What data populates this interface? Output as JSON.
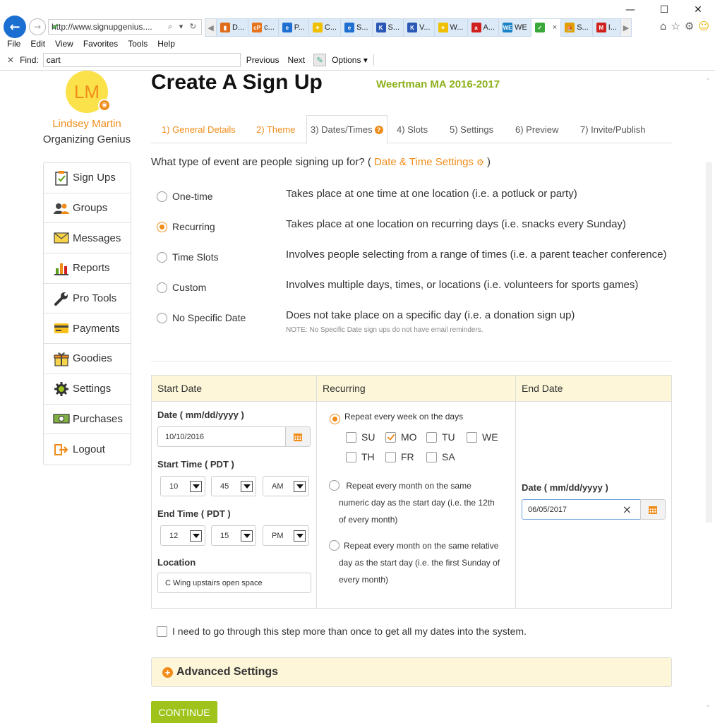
{
  "browser": {
    "address": "http://www.signupgenius....",
    "address_tools": "⌕ ▾ ↻",
    "tabs": [
      {
        "label": "D...",
        "color": "#e06b1a",
        "glyph": "▮"
      },
      {
        "label": "c...",
        "color": "#e8731c",
        "glyph": "cP"
      },
      {
        "label": "P...",
        "color": "#1e6fd0",
        "glyph": "e"
      },
      {
        "label": "C...",
        "color": "#f0c000",
        "glyph": "✦"
      },
      {
        "label": "S...",
        "color": "#1e6fd0",
        "glyph": "e"
      },
      {
        "label": "S...",
        "color": "#2b57b5",
        "glyph": "K"
      },
      {
        "label": "V...",
        "color": "#2b57b5",
        "glyph": "K"
      },
      {
        "label": "W...",
        "color": "#f0c000",
        "glyph": "✦"
      },
      {
        "label": "A...",
        "color": "#d0201e",
        "glyph": "a"
      },
      {
        "label": "WE",
        "color": "#1b82c8",
        "glyph": "WE"
      },
      {
        "label": "",
        "color": "#3aa83a",
        "glyph": "✓",
        "active": true,
        "close": "×"
      },
      {
        "label": "S...",
        "color": "#e0a000",
        "glyph": "⛵"
      },
      {
        "label": "I...",
        "color": "#d0201e",
        "glyph": "M"
      }
    ],
    "menu": [
      "File",
      "Edit",
      "View",
      "Favorites",
      "Tools",
      "Help"
    ],
    "find": {
      "label": "Find:",
      "value": "cart",
      "previous": "Previous",
      "next": "Next",
      "options": "Options ▾"
    }
  },
  "user": {
    "initials": "LM",
    "name": "Lindsey Martin",
    "role": "Organizing Genius"
  },
  "sidebar": {
    "items": [
      {
        "label": "Sign Ups",
        "icon": "clipboard-check-icon"
      },
      {
        "label": "Groups",
        "icon": "people-icon"
      },
      {
        "label": "Messages",
        "icon": "envelope-icon"
      },
      {
        "label": "Reports",
        "icon": "bar-chart-icon"
      },
      {
        "label": "Pro Tools",
        "icon": "wrench-icon"
      },
      {
        "label": "Payments",
        "icon": "credit-card-icon"
      },
      {
        "label": "Goodies",
        "icon": "gift-icon"
      },
      {
        "label": "Settings",
        "icon": "gear-icon"
      },
      {
        "label": "Purchases",
        "icon": "money-icon"
      },
      {
        "label": "Logout",
        "icon": "logout-icon"
      }
    ]
  },
  "header": {
    "title": "Create A Sign Up",
    "group": "Weertman MA 2016-2017"
  },
  "steps": [
    {
      "label": "1) General Details",
      "state": "done"
    },
    {
      "label": "2) Theme",
      "state": "done"
    },
    {
      "label": "3) Dates/Times",
      "state": "current"
    },
    {
      "label": "4) Slots",
      "state": "todo"
    },
    {
      "label": "5) Settings",
      "state": "todo"
    },
    {
      "label": "6) Preview",
      "state": "todo"
    },
    {
      "label": "7) Invite/Publish",
      "state": "todo"
    }
  ],
  "question": {
    "text": "What type of event are people signing up for? (",
    "link": "Date & Time Settings",
    "close": ")"
  },
  "event_types": [
    {
      "label": "One-time",
      "desc": "Takes place at one time at one location (i.e. a potluck or party)",
      "selected": false
    },
    {
      "label": "Recurring",
      "desc": "Takes place at one location on recurring days (i.e. snacks every Sunday)",
      "selected": true
    },
    {
      "label": "Time Slots",
      "desc": "Involves people selecting from a range of times (i.e. a parent teacher conference)",
      "selected": false
    },
    {
      "label": "Custom",
      "desc": "Involves multiple days, times, or locations (i.e. volunteers for sports games)",
      "selected": false
    },
    {
      "label": "No Specific Date",
      "desc": "Does not take place on a specific day (i.e. a donation sign up)",
      "selected": false
    }
  ],
  "note": "NOTE: No Specific Date sign ups do not have email reminders.",
  "start": {
    "header": "Start Date",
    "date_label": "Date ( mm/dd/yyyy )",
    "date_value": "10/10/2016",
    "start_time_label": "Start Time ( PDT )",
    "start_hour": "10",
    "start_min": "45",
    "start_ampm": "AM",
    "end_time_label": "End Time ( PDT )",
    "end_hour": "12",
    "end_min": "15",
    "end_ampm": "PM",
    "location_label": "Location",
    "location_value": "C Wing upstairs open space"
  },
  "recurring": {
    "header": "Recurring",
    "weekly": "Repeat every week on the days",
    "days": [
      {
        "label": "SU",
        "checked": false
      },
      {
        "label": "MO",
        "checked": true
      },
      {
        "label": "TU",
        "checked": false
      },
      {
        "label": "WE",
        "checked": false
      },
      {
        "label": "TH",
        "checked": false
      },
      {
        "label": "FR",
        "checked": false
      },
      {
        "label": "SA",
        "checked": false
      }
    ],
    "monthly_numeric": [
      "Repeat every month on the same",
      "numeric day as the start day (i.e. the 12th",
      "of every month)"
    ],
    "monthly_relative": [
      "Repeat every month on the same relative",
      "day as the start day (i.e. the first Sunday of",
      "every month)"
    ]
  },
  "end": {
    "header": "End Date",
    "date_label": "Date ( mm/dd/yyyy )",
    "date_value": "06/05/2017",
    "clear": "×"
  },
  "multi_step": "I need to go through this step more than once to get all my dates into the system.",
  "advanced": "Advanced Settings",
  "continue": "CONTINUE",
  "colors": {
    "accent": "#f08c1a",
    "brand_green": "#9fc31b",
    "panel_header": "#fdf6d8"
  }
}
